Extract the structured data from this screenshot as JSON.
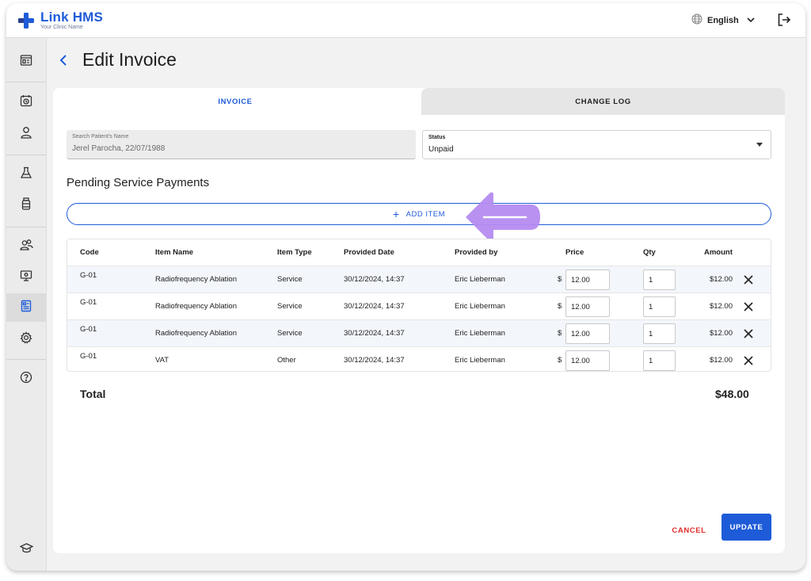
{
  "app": {
    "brand_name_a": "Link",
    "brand_name_b": "HMS",
    "brand_sub": "Your Clinic Name",
    "accent": "#1e5bd8"
  },
  "header": {
    "language": "English"
  },
  "page": {
    "title": "Edit Invoice"
  },
  "tabs": [
    {
      "label": "INVOICE",
      "active": true
    },
    {
      "label": "CHANGE LOG",
      "active": false
    }
  ],
  "form": {
    "patient_label": "Search Patient's Name",
    "patient_value": "Jerel Parocha, 22/07/1988",
    "status_label": "Status",
    "status_value": "Unpaid"
  },
  "section": {
    "title": "Pending Service Payments",
    "add_item_label": "ADD ITEM"
  },
  "table": {
    "headers": [
      "Code",
      "Item Name",
      "Item Type",
      "Provided Date",
      "Provided by",
      "Price",
      "Qty",
      "Amount"
    ],
    "currency_symbol": "$",
    "rows": [
      {
        "code": "G-01",
        "item_name": "Radiofrequency Ablation",
        "item_type": "Service",
        "provided_date": "30/12/2024, 14:37",
        "provided_by": "Eric Lieberman",
        "price": "12.00",
        "qty": "1",
        "amount": "$12.00"
      },
      {
        "code": "G-01",
        "item_name": "Radiofrequency Ablation",
        "item_type": "Service",
        "provided_date": "30/12/2024, 14:37",
        "provided_by": "Eric Lieberman",
        "price": "12.00",
        "qty": "1",
        "amount": "$12.00"
      },
      {
        "code": "G-01",
        "item_name": "Radiofrequency Ablation",
        "item_type": "Service",
        "provided_date": "30/12/2024, 14:37",
        "provided_by": "Eric Lieberman",
        "price": "12.00",
        "qty": "1",
        "amount": "$12.00"
      },
      {
        "code": "G-01",
        "item_name": "VAT",
        "item_type": "Other",
        "provided_date": "30/12/2024, 14:37",
        "provided_by": "Eric Lieberman",
        "price": "12.00",
        "qty": "1",
        "amount": "$12.00"
      }
    ]
  },
  "total": {
    "label": "Total",
    "value": "$48.00"
  },
  "actions": {
    "cancel_label": "CANCEL",
    "update_label": "UPDATE"
  },
  "sidebar": {
    "items": [
      {
        "icon": "dashboard-icon"
      },
      {
        "icon": "appointments-icon"
      },
      {
        "icon": "patient-icon"
      },
      {
        "icon": "lab-flask-icon"
      },
      {
        "icon": "pharmacy-bottle-icon"
      },
      {
        "icon": "staff-icon"
      },
      {
        "icon": "monitor-icon"
      },
      {
        "icon": "billing-icon",
        "active": true
      },
      {
        "icon": "settings-icon"
      },
      {
        "icon": "help-icon"
      },
      {
        "icon": "education-icon"
      }
    ]
  }
}
